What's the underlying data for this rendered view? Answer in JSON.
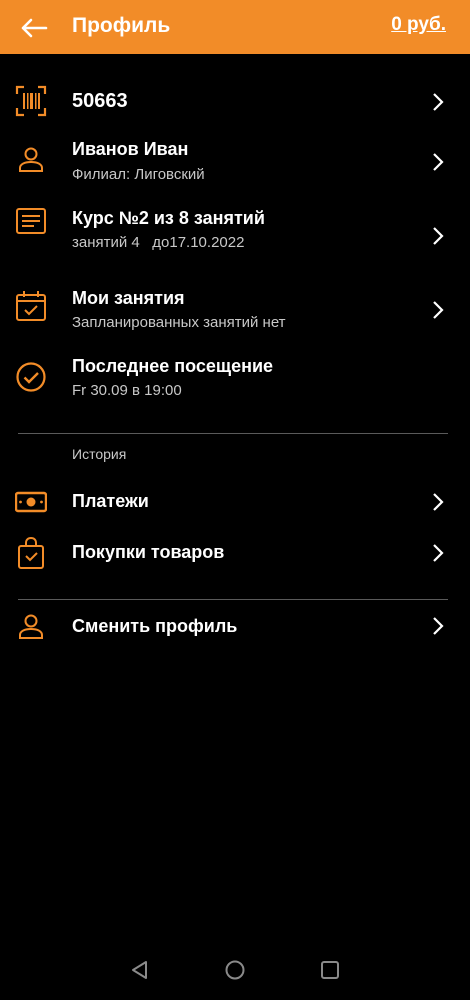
{
  "header": {
    "title": "Профиль",
    "balance": "0 руб."
  },
  "colors": {
    "accent": "#f28c28",
    "background": "#000000",
    "text": "#ffffff",
    "subtext": "#c8c8c8",
    "divider": "#5a5a5a"
  },
  "rows": {
    "card": {
      "icon": "barcode-icon",
      "title": "50663"
    },
    "profile": {
      "icon": "person-icon",
      "title": "Иванов Иван",
      "sub": "Филиал: Лиговский"
    },
    "course": {
      "icon": "document-icon",
      "title": "Курс №2 из 8 занятий",
      "sub": "занятий 4   до17.10.2022"
    },
    "classes": {
      "icon": "calendar-check-icon",
      "title": "Мои занятия",
      "sub": "Запланированных занятий нет"
    },
    "last_visit": {
      "icon": "check-circle-icon",
      "title": "Последнее посещение",
      "sub": "Fr 30.09 в 19:00"
    }
  },
  "history": {
    "label": "История",
    "payments": {
      "icon": "cash-icon",
      "title": "Платежи"
    },
    "purchases": {
      "icon": "shopping-bag-icon",
      "title": "Покупки товаров"
    }
  },
  "switch_profile": {
    "icon": "person-icon",
    "title": "Сменить профиль"
  },
  "system_nav": {
    "back": "back-triangle-icon",
    "home": "home-circle-icon",
    "recents": "recents-square-icon"
  }
}
